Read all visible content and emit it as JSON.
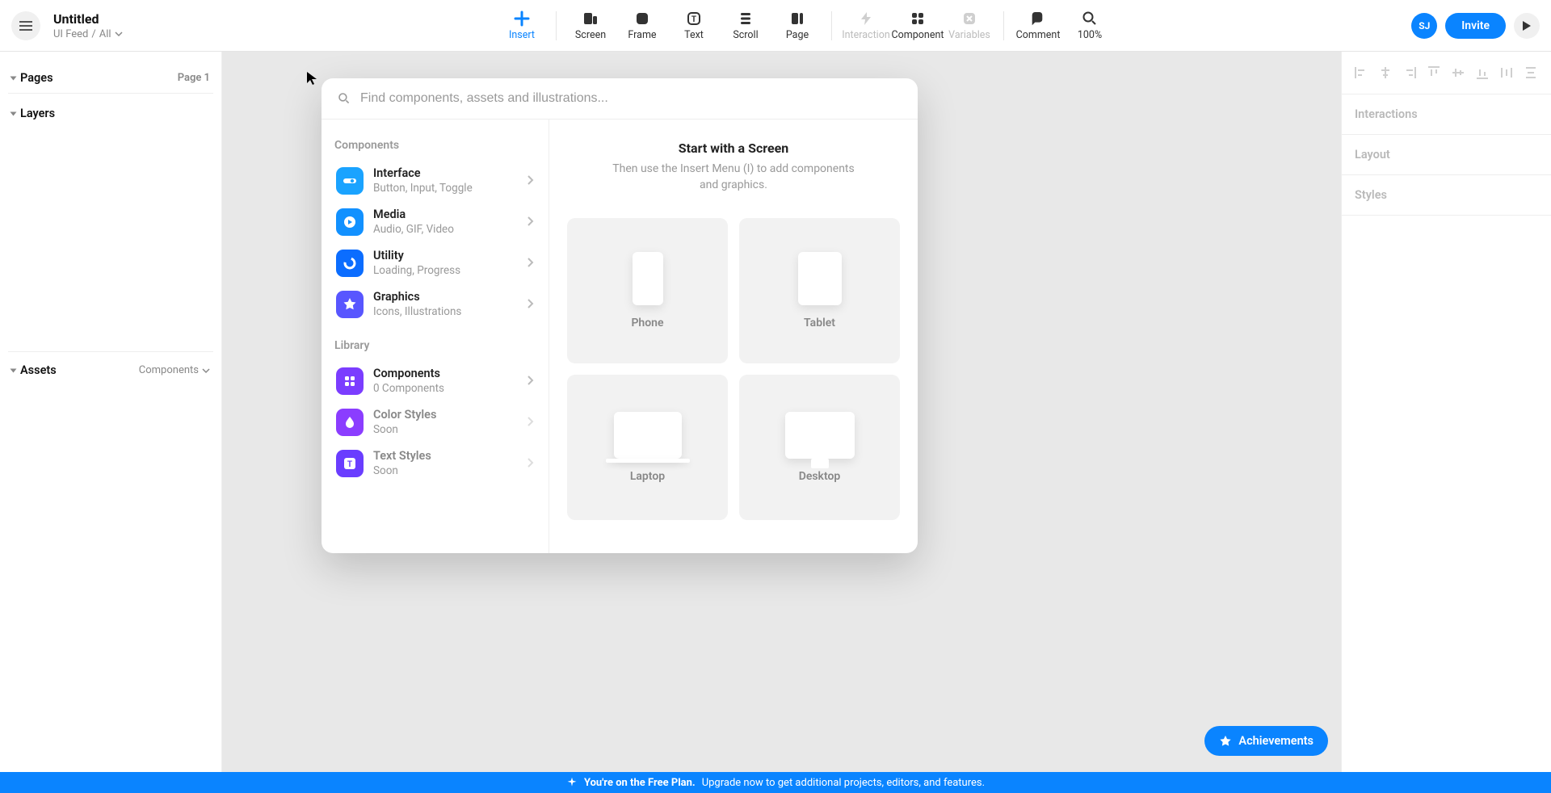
{
  "header": {
    "title": "Untitled",
    "breadcrumb1": "UI Feed",
    "breadcrumb2": "All"
  },
  "toolbar": {
    "insert": "Insert",
    "screen": "Screen",
    "frame": "Frame",
    "text": "Text",
    "scroll": "Scroll",
    "page": "Page",
    "interaction": "Interaction",
    "component": "Component",
    "variables": "Variables",
    "comment": "Comment",
    "zoom": "100%"
  },
  "user": {
    "initials": "SJ",
    "invite": "Invite"
  },
  "left": {
    "pages": "Pages",
    "page_current": "Page 1",
    "layers": "Layers",
    "assets": "Assets",
    "assets_dd": "Components"
  },
  "right": {
    "interactions": "Interactions",
    "layout": "Layout",
    "styles": "Styles"
  },
  "popover": {
    "search_placeholder": "Find components, assets and illustrations...",
    "section_components": "Components",
    "section_library": "Library",
    "items": {
      "interface": {
        "title": "Interface",
        "sub": "Button, Input, Toggle"
      },
      "media": {
        "title": "Media",
        "sub": "Audio, GIF, Video"
      },
      "utility": {
        "title": "Utility",
        "sub": "Loading, Progress"
      },
      "graphics": {
        "title": "Graphics",
        "sub": "Icons, Illustrations"
      },
      "components": {
        "title": "Components",
        "sub": "0 Components"
      },
      "colorstyles": {
        "title": "Color Styles",
        "sub": "Soon"
      },
      "textstyles": {
        "title": "Text Styles",
        "sub": "Soon"
      }
    },
    "start_title": "Start with a Screen",
    "start_sub": "Then use the Insert Menu (I) to add components and graphics.",
    "screens": {
      "phone": "Phone",
      "tablet": "Tablet",
      "laptop": "Laptop",
      "desktop": "Desktop"
    }
  },
  "achievements": "Achievements",
  "banner": {
    "bold": "You're on the Free Plan.",
    "rest": "Upgrade now to get additional projects, editors, and features."
  }
}
